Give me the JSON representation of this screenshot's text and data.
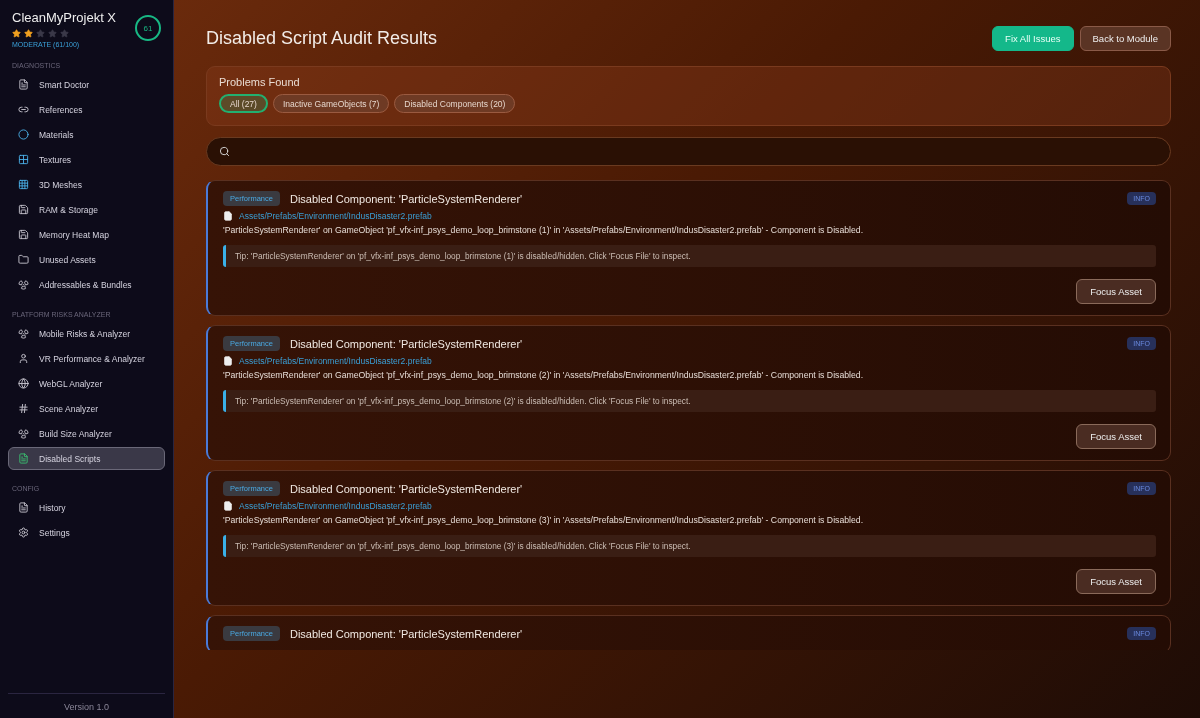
{
  "sidebar": {
    "app_name": "CleanMyProjekt X",
    "stars": 2,
    "score": "61",
    "rating": "MODERATE (61/100)",
    "sections": [
      {
        "title": "DIAGNOSTICS",
        "items": [
          {
            "label": "Smart Doctor",
            "selected": false
          },
          {
            "label": "References",
            "selected": false
          },
          {
            "label": "Materials",
            "selected": false
          },
          {
            "label": "Textures",
            "selected": false
          },
          {
            "label": "3D Meshes",
            "selected": false
          },
          {
            "label": "RAM & Storage",
            "selected": false
          },
          {
            "label": "Memory Heat Map",
            "selected": false
          },
          {
            "label": "Unused Assets",
            "selected": false
          },
          {
            "label": "Addressables & Bundles",
            "selected": false
          }
        ]
      },
      {
        "title": "PLATFORM RISKS ANALYZER",
        "items": [
          {
            "label": "Mobile Risks & Analyzer",
            "selected": false
          },
          {
            "label": "VR Performance & Analyzer",
            "selected": false
          },
          {
            "label": "WebGL Analyzer",
            "selected": false
          },
          {
            "label": "Scene Analyzer",
            "selected": false
          },
          {
            "label": "Build Size Analyzer",
            "selected": false
          },
          {
            "label": "Disabled Scripts",
            "selected": true
          }
        ]
      },
      {
        "title": "CONFIG",
        "items": [
          {
            "label": "History",
            "selected": false
          },
          {
            "label": "Settings",
            "selected": false
          }
        ]
      }
    ],
    "version": "Version 1.0"
  },
  "page": {
    "title": "Disabled Script Audit Results",
    "buttons": [
      {
        "label": "Fix All Issues",
        "kind": "primary"
      },
      {
        "label": "Back to Module",
        "kind": "secondary"
      }
    ]
  },
  "problems": {
    "title": "Problems Found",
    "filters": [
      {
        "label": "All (27)",
        "selected": true
      },
      {
        "label": "Inactive GameObjects (7)",
        "selected": false
      },
      {
        "label": "Disabled Components (20)",
        "selected": false
      }
    ]
  },
  "issues": [
    {
      "tag": "Performance",
      "title": "Disabled Component: 'ParticleSystemRenderer'",
      "badge": "INFO",
      "path": "Assets/Prefabs/Environment/IndusDisaster2.prefab",
      "description": "'ParticleSystemRenderer' on GameObject 'pf_vfx-inf_psys_demo_loop_brimstone (1)' in 'Assets/Prefabs/Environment/IndusDisaster2.prefab' - Component is Disabled.",
      "tip": "Tip: 'ParticleSystemRenderer' on 'pf_vfx-inf_psys_demo_loop_brimstone (1)' is disabled/hidden. Click 'Focus File' to inspect.",
      "action": "Focus Asset"
    },
    {
      "tag": "Performance",
      "title": "Disabled Component: 'ParticleSystemRenderer'",
      "badge": "INFO",
      "path": "Assets/Prefabs/Environment/IndusDisaster2.prefab",
      "description": "'ParticleSystemRenderer' on GameObject 'pf_vfx-inf_psys_demo_loop_brimstone (2)' in 'Assets/Prefabs/Environment/IndusDisaster2.prefab' - Component is Disabled.",
      "tip": "Tip: 'ParticleSystemRenderer' on 'pf_vfx-inf_psys_demo_loop_brimstone (2)' is disabled/hidden. Click 'Focus File' to inspect.",
      "action": "Focus Asset"
    },
    {
      "tag": "Performance",
      "title": "Disabled Component: 'ParticleSystemRenderer'",
      "badge": "INFO",
      "path": "Assets/Prefabs/Environment/IndusDisaster2.prefab",
      "description": "'ParticleSystemRenderer' on GameObject 'pf_vfx-inf_psys_demo_loop_brimstone (3)' in 'Assets/Prefabs/Environment/IndusDisaster2.prefab' - Component is Disabled.",
      "tip": "Tip: 'ParticleSystemRenderer' on 'pf_vfx-inf_psys_demo_loop_brimstone (3)' is disabled/hidden. Click 'Focus File' to inspect.",
      "action": "Focus Asset"
    },
    {
      "tag": "Performance",
      "title": "Disabled Component: 'ParticleSystemRenderer'",
      "badge": "INFO"
    }
  ]
}
